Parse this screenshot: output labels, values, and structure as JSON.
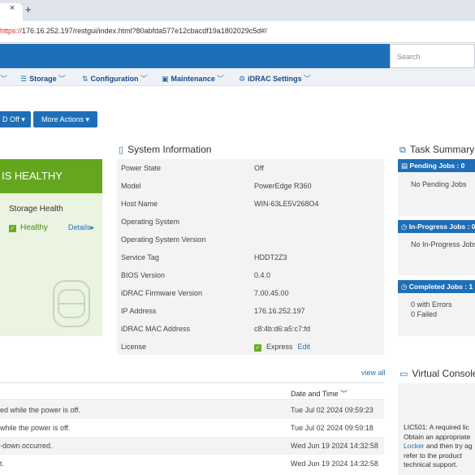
{
  "browser": {
    "tab_close": "×",
    "new_tab": "+",
    "url_scheme": "https://",
    "url_rest": "176.16.252.197/restgui/index.html?80abfda577e12cbacdf19a1802029c5d#/"
  },
  "header": {
    "search_placeholder": "Search"
  },
  "menu": [
    {
      "icon": "chevron-down-icon",
      "label": "",
      "chevron": "﹀"
    },
    {
      "icon": "storage-icon",
      "glyph": "☰",
      "label": "Storage",
      "chevron": "﹀"
    },
    {
      "icon": "configuration-icon",
      "glyph": "⇅",
      "label": "Configuration",
      "chevron": "﹀"
    },
    {
      "icon": "maintenance-icon",
      "glyph": "▣",
      "label": "Maintenance",
      "chevron": "﹀"
    },
    {
      "icon": "idrac-settings-icon",
      "glyph": "⚙",
      "label": "iDRAC Settings",
      "chevron": "﹀"
    }
  ],
  "actions": {
    "power_button": "D Off ▾",
    "more_actions": "More Actions ▾"
  },
  "health": {
    "banner": "IS HEALTHY",
    "storage_title": "Storage Health",
    "storage_status": "Healthy",
    "details": "Details▸",
    "check": "✓"
  },
  "system_info": {
    "title": "System Information",
    "rows": [
      {
        "label": "Power State",
        "value": "Off"
      },
      {
        "label": "Model",
        "value": "PowerEdge R360"
      },
      {
        "label": "Host Name",
        "value": "WIN-63LE5V268O4"
      },
      {
        "label": "Operating System",
        "value": ""
      },
      {
        "label": "Operating System Version",
        "value": ""
      },
      {
        "label": "Service Tag",
        "value": "HDDT2Z3"
      },
      {
        "label": "BIOS Version",
        "value": "0.4.0"
      },
      {
        "label": "iDRAC Firmware Version",
        "value": "7.00.45.00"
      },
      {
        "label": "IP Address",
        "value": "176.16.252.197"
      },
      {
        "label": "iDRAC MAC Address",
        "value": "c8:4b:d6:a5:c7:fd"
      }
    ],
    "license_label": "License",
    "license_value": "Express",
    "license_edit": "Edit"
  },
  "task_summary": {
    "title": "Task Summary",
    "pending_header": "Pending Jobs : 0",
    "pending_body": "No Pending Jobs",
    "inprogress_header": "In-Progress Jobs : 0",
    "inprogress_body": "No In-Progress Jobs",
    "completed_header": "Completed Jobs : 1",
    "completed_errors": "0  with Errors",
    "completed_failed": "0  Failed"
  },
  "logs": {
    "view_all": "view all",
    "date_header": "Date and Time ﹀",
    "rows": [
      {
        "message": "ed while the power is off.",
        "time": "Tue Jul 02 2024 09:59:23"
      },
      {
        "message": " while the power is off.",
        "time": "Tue Jul 02 2024 09:59:18"
      },
      {
        "message": "-down occurred.",
        "time": "Wed Jun 19 2024 14:32:58"
      },
      {
        "message": "t.",
        "time": "Wed Jun 19 2024 14:32:58"
      }
    ]
  },
  "virtual_console": {
    "title": "Virtual Console",
    "line1": "LIC501: A required lic",
    "line2": "Obtain an appropriate",
    "line3_link": "Locker",
    "line3_rest": " and then try ag",
    "line4": "refer to the product",
    "line5": "technical support."
  },
  "colors": {
    "accent": "#1f6fb8",
    "healthy": "#64a71e",
    "healthy_panel": "#ebf3e1",
    "panel_gray": "#f3f3f3"
  }
}
